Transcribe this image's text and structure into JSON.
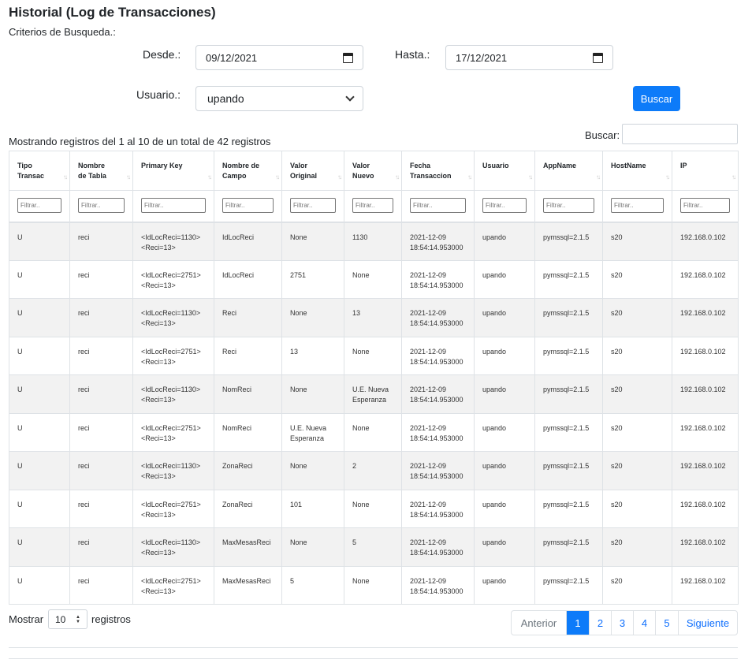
{
  "page": {
    "title": "Historial (Log de Transacciones)",
    "criteria_label": "Criterios de Busqueda.:"
  },
  "form": {
    "desde_label": "Desde.:",
    "desde_value": "09/12/2021",
    "hasta_label": "Hasta.:",
    "hasta_value": "17/12/2021",
    "usuario_label": "Usuario.:",
    "usuario_value": "upando",
    "buscar_button": "Buscar"
  },
  "table_info": {
    "showing": "Mostrando registros del 1 al 10 de un total de 42 registros",
    "search_label": "Buscar:",
    "search_value": ""
  },
  "table": {
    "headers": [
      [
        "Tipo",
        "Transac"
      ],
      [
        "Nombre",
        "de Tabla"
      ],
      [
        "Primary Key",
        ""
      ],
      [
        "Nombre de",
        "Campo"
      ],
      [
        "Valor",
        "Original"
      ],
      [
        "Valor",
        "Nuevo"
      ],
      [
        "Fecha",
        "Transaccion"
      ],
      [
        "Usuario",
        ""
      ],
      [
        "AppName",
        ""
      ],
      [
        "HostName",
        ""
      ],
      [
        "IP",
        ""
      ]
    ],
    "filter_placeholder": "Filtrar..",
    "rows": [
      [
        "U",
        "reci",
        "<IdLocReci=1130>",
        "<Reci=13>",
        "IdLocReci",
        "None",
        "",
        "1130",
        "",
        "2021-12-09",
        "18:54:14.953000",
        "upando",
        "pymssql=2.1.5",
        "s20",
        "192.168.0.102"
      ],
      [
        "U",
        "reci",
        "<IdLocReci=2751>",
        "<Reci=13>",
        "IdLocReci",
        "2751",
        "",
        "None",
        "",
        "2021-12-09",
        "18:54:14.953000",
        "upando",
        "pymssql=2.1.5",
        "s20",
        "192.168.0.102"
      ],
      [
        "U",
        "reci",
        "<IdLocReci=1130>",
        "<Reci=13>",
        "Reci",
        "None",
        "",
        "13",
        "",
        "2021-12-09",
        "18:54:14.953000",
        "upando",
        "pymssql=2.1.5",
        "s20",
        "192.168.0.102"
      ],
      [
        "U",
        "reci",
        "<IdLocReci=2751>",
        "<Reci=13>",
        "Reci",
        "13",
        "",
        "None",
        "",
        "2021-12-09",
        "18:54:14.953000",
        "upando",
        "pymssql=2.1.5",
        "s20",
        "192.168.0.102"
      ],
      [
        "U",
        "reci",
        "<IdLocReci=1130>",
        "<Reci=13>",
        "NomReci",
        "None",
        "",
        "U.E. Nueva",
        "Esperanza",
        "2021-12-09",
        "18:54:14.953000",
        "upando",
        "pymssql=2.1.5",
        "s20",
        "192.168.0.102"
      ],
      [
        "U",
        "reci",
        "<IdLocReci=2751>",
        "<Reci=13>",
        "NomReci",
        "U.E. Nueva",
        "Esperanza",
        "None",
        "",
        "2021-12-09",
        "18:54:14.953000",
        "upando",
        "pymssql=2.1.5",
        "s20",
        "192.168.0.102"
      ],
      [
        "U",
        "reci",
        "<IdLocReci=1130>",
        "<Reci=13>",
        "ZonaReci",
        "None",
        "",
        "2",
        "",
        "2021-12-09",
        "18:54:14.953000",
        "upando",
        "pymssql=2.1.5",
        "s20",
        "192.168.0.102"
      ],
      [
        "U",
        "reci",
        "<IdLocReci=2751>",
        "<Reci=13>",
        "ZonaReci",
        "101",
        "",
        "None",
        "",
        "2021-12-09",
        "18:54:14.953000",
        "upando",
        "pymssql=2.1.5",
        "s20",
        "192.168.0.102"
      ],
      [
        "U",
        "reci",
        "<IdLocReci=1130>",
        "<Reci=13>",
        "MaxMesasReci",
        "None",
        "",
        "5",
        "",
        "2021-12-09",
        "18:54:14.953000",
        "upando",
        "pymssql=2.1.5",
        "s20",
        "192.168.0.102"
      ],
      [
        "U",
        "reci",
        "<IdLocReci=2751>",
        "<Reci=13>",
        "MaxMesasReci",
        "5",
        "",
        "None",
        "",
        "2021-12-09",
        "18:54:14.953000",
        "upando",
        "pymssql=2.1.5",
        "s20",
        "192.168.0.102"
      ]
    ]
  },
  "footer": {
    "show_label": "Mostrar",
    "page_length": "10",
    "records_label": "registros",
    "pagination": [
      "Anterior",
      "1",
      "2",
      "3",
      "4",
      "5",
      "Siguiente"
    ],
    "active_page": "1"
  },
  "colors": {
    "primary": "#0d7bf9",
    "stripe": "#f2f2f2",
    "border": "#dee2e6"
  }
}
